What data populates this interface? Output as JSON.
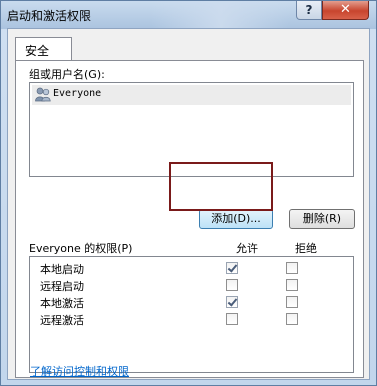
{
  "window": {
    "title": "启动和激活权限",
    "help_label": "?",
    "close_label": "✕"
  },
  "tab": {
    "label": "安全"
  },
  "group": {
    "label": "组或用户名(G):",
    "users": [
      {
        "name": "Everyone",
        "icon": "users-group-icon"
      }
    ],
    "add_button": "添加(D)...",
    "remove_button": "删除(R)"
  },
  "permissions": {
    "label": "Everyone 的权限(P)",
    "allow_header": "允许",
    "deny_header": "拒绝",
    "rows": [
      {
        "name": "本地启动",
        "allow": true,
        "deny": false
      },
      {
        "name": "远程启动",
        "allow": false,
        "deny": false
      },
      {
        "name": "本地激活",
        "allow": true,
        "deny": false
      },
      {
        "name": "远程激活",
        "allow": false,
        "deny": false
      }
    ]
  },
  "footer": {
    "link": "了解访问控制和权限"
  },
  "colors": {
    "highlight_box": "#7a1a1a",
    "link": "#0066cc",
    "close_button": "#c8452e"
  }
}
